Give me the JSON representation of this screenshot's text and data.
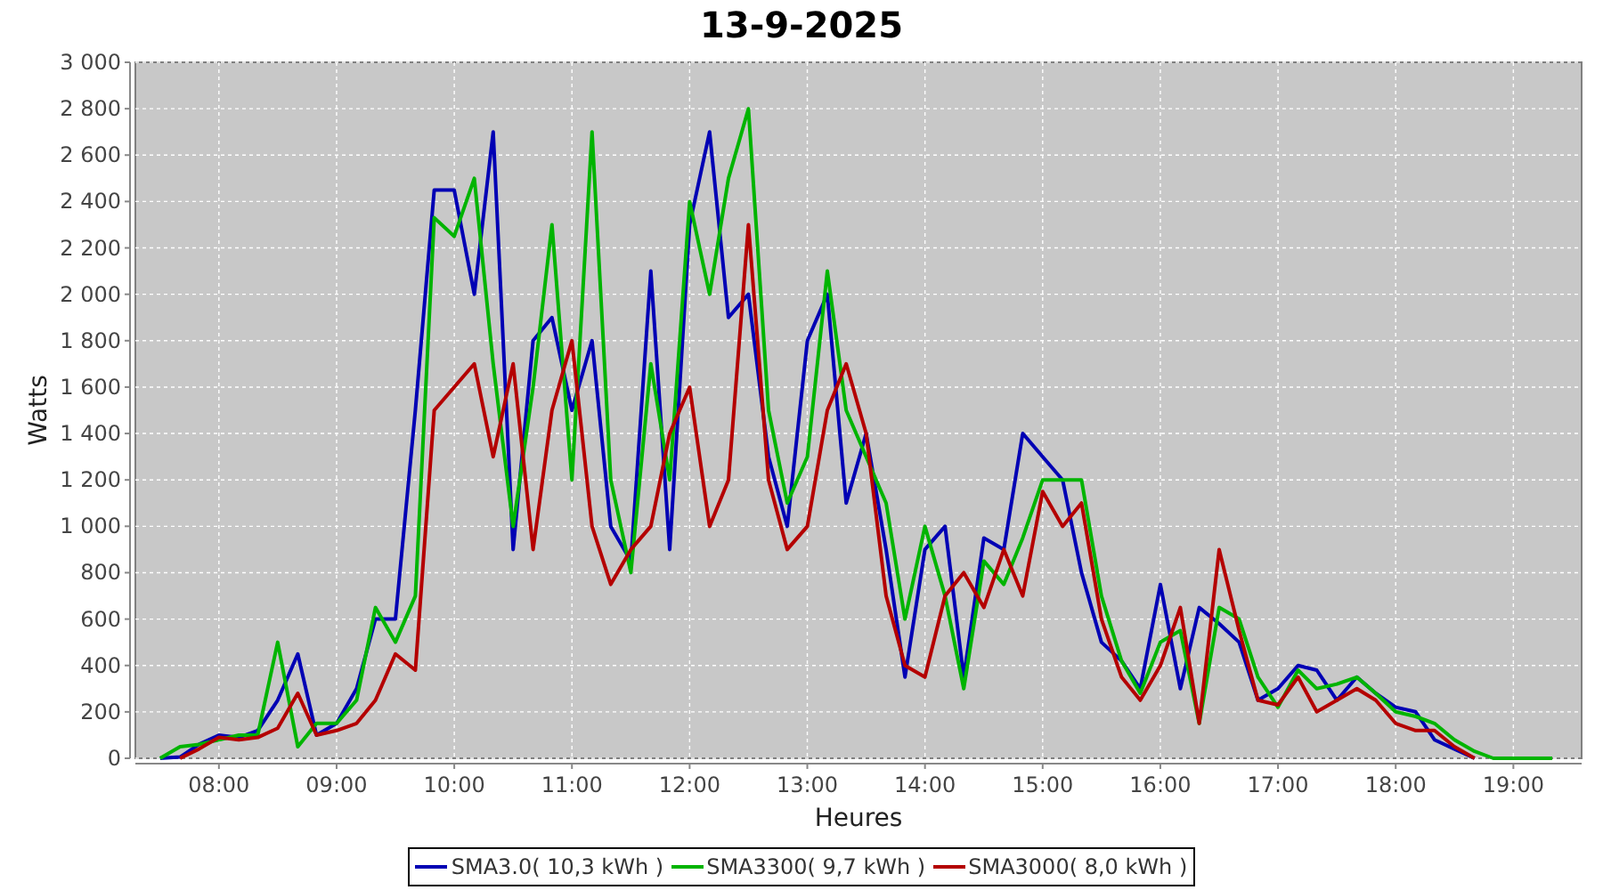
{
  "chart_data": {
    "type": "line",
    "title": "13-9-2025",
    "xlabel": "Heures",
    "ylabel": "Watts",
    "x": [
      7.5,
      7.67,
      7.83,
      8,
      8.17,
      8.33,
      8.5,
      8.67,
      8.83,
      9,
      9.17,
      9.33,
      9.5,
      9.67,
      9.83,
      10,
      10.17,
      10.33,
      10.5,
      10.67,
      10.83,
      11,
      11.17,
      11.33,
      11.5,
      11.67,
      11.83,
      12,
      12.17,
      12.33,
      12.5,
      12.67,
      12.83,
      13,
      13.17,
      13.33,
      13.5,
      13.67,
      13.83,
      14,
      14.17,
      14.33,
      14.5,
      14.67,
      14.83,
      15,
      15.17,
      15.33,
      15.5,
      15.67,
      15.83,
      16,
      16.17,
      16.33,
      16.5,
      16.67,
      16.83,
      17,
      17.17,
      17.33,
      17.5,
      17.67,
      17.83,
      18,
      18.17,
      18.33,
      18.5,
      18.67,
      18.83,
      19,
      19.17,
      19.33
    ],
    "series": [
      {
        "name": "SMA3.0( 10,3 kWh )",
        "color": "#0000b4",
        "values": [
          0,
          5,
          60,
          100,
          90,
          120,
          250,
          450,
          100,
          150,
          300,
          600,
          600,
          1500,
          2450,
          2450,
          2000,
          2700,
          900,
          1800,
          1900,
          1500,
          1800,
          1000,
          850,
          2100,
          900,
          2300,
          2700,
          1900,
          2000,
          1300,
          1000,
          1800,
          2000,
          1100,
          1400,
          900,
          350,
          900,
          1000,
          350,
          950,
          900,
          1400,
          1300,
          1200,
          800,
          500,
          420,
          300,
          750,
          300,
          650,
          580,
          500,
          250,
          300,
          400,
          380,
          250,
          350,
          280,
          220,
          200,
          80,
          40,
          0,
          null,
          null,
          null,
          null
        ]
      },
      {
        "name": "SMA3300( 9,7 kWh )",
        "color": "#00b400",
        "values": [
          0,
          50,
          60,
          80,
          100,
          100,
          500,
          50,
          150,
          150,
          250,
          650,
          500,
          700,
          2330,
          2250,
          2500,
          1700,
          1000,
          1600,
          2300,
          1200,
          2700,
          1200,
          800,
          1700,
          1200,
          2400,
          2000,
          2500,
          2800,
          1500,
          1100,
          1300,
          2100,
          1500,
          1300,
          1100,
          600,
          1000,
          700,
          300,
          850,
          750,
          950,
          1200,
          1200,
          1200,
          700,
          420,
          280,
          500,
          550,
          150,
          650,
          600,
          350,
          220,
          380,
          300,
          320,
          350,
          280,
          200,
          180,
          150,
          80,
          30,
          0,
          0,
          0,
          0
        ]
      },
      {
        "name": "SMA3000( 8,0 kWh )",
        "color": "#b40000",
        "values": [
          null,
          0,
          40,
          90,
          80,
          90,
          130,
          280,
          100,
          120,
          150,
          250,
          450,
          380,
          1500,
          1600,
          1700,
          1300,
          1700,
          900,
          1500,
          1800,
          1000,
          750,
          900,
          1000,
          1400,
          1600,
          1000,
          1200,
          2300,
          1200,
          900,
          1000,
          1500,
          1700,
          1400,
          700,
          400,
          350,
          700,
          800,
          650,
          900,
          700,
          1150,
          1000,
          1100,
          600,
          350,
          250,
          400,
          650,
          150,
          900,
          550,
          250,
          230,
          350,
          200,
          250,
          300,
          250,
          150,
          120,
          120,
          50,
          0,
          null,
          null,
          null,
          null
        ]
      }
    ],
    "grid": true,
    "xlim": [
      7.29,
      19.58
    ],
    "ylim": [
      0,
      3000
    ],
    "xticks": [
      {
        "value": 8,
        "label": "08:00"
      },
      {
        "value": 9,
        "label": "09:00"
      },
      {
        "value": 10,
        "label": "10:00"
      },
      {
        "value": 11,
        "label": "11:00"
      },
      {
        "value": 12,
        "label": "12:00"
      },
      {
        "value": 13,
        "label": "13:00"
      },
      {
        "value": 14,
        "label": "14:00"
      },
      {
        "value": 15,
        "label": "15:00"
      },
      {
        "value": 16,
        "label": "16:00"
      },
      {
        "value": 17,
        "label": "17:00"
      },
      {
        "value": 18,
        "label": "18:00"
      },
      {
        "value": 19,
        "label": "19:00"
      }
    ],
    "yticks": [
      {
        "value": 0,
        "label": "0"
      },
      {
        "value": 200,
        "label": "200"
      },
      {
        "value": 400,
        "label": "400"
      },
      {
        "value": 600,
        "label": "600"
      },
      {
        "value": 800,
        "label": "800"
      },
      {
        "value": 1000,
        "label": "1 000"
      },
      {
        "value": 1200,
        "label": "1 200"
      },
      {
        "value": 1400,
        "label": "1 400"
      },
      {
        "value": 1600,
        "label": "1 600"
      },
      {
        "value": 1800,
        "label": "1 800"
      },
      {
        "value": 2000,
        "label": "2 000"
      },
      {
        "value": 2200,
        "label": "2 200"
      },
      {
        "value": 2400,
        "label": "2 400"
      },
      {
        "value": 2600,
        "label": "2 600"
      },
      {
        "value": 2800,
        "label": "2 800"
      },
      {
        "value": 3000,
        "label": "3 000"
      }
    ]
  }
}
